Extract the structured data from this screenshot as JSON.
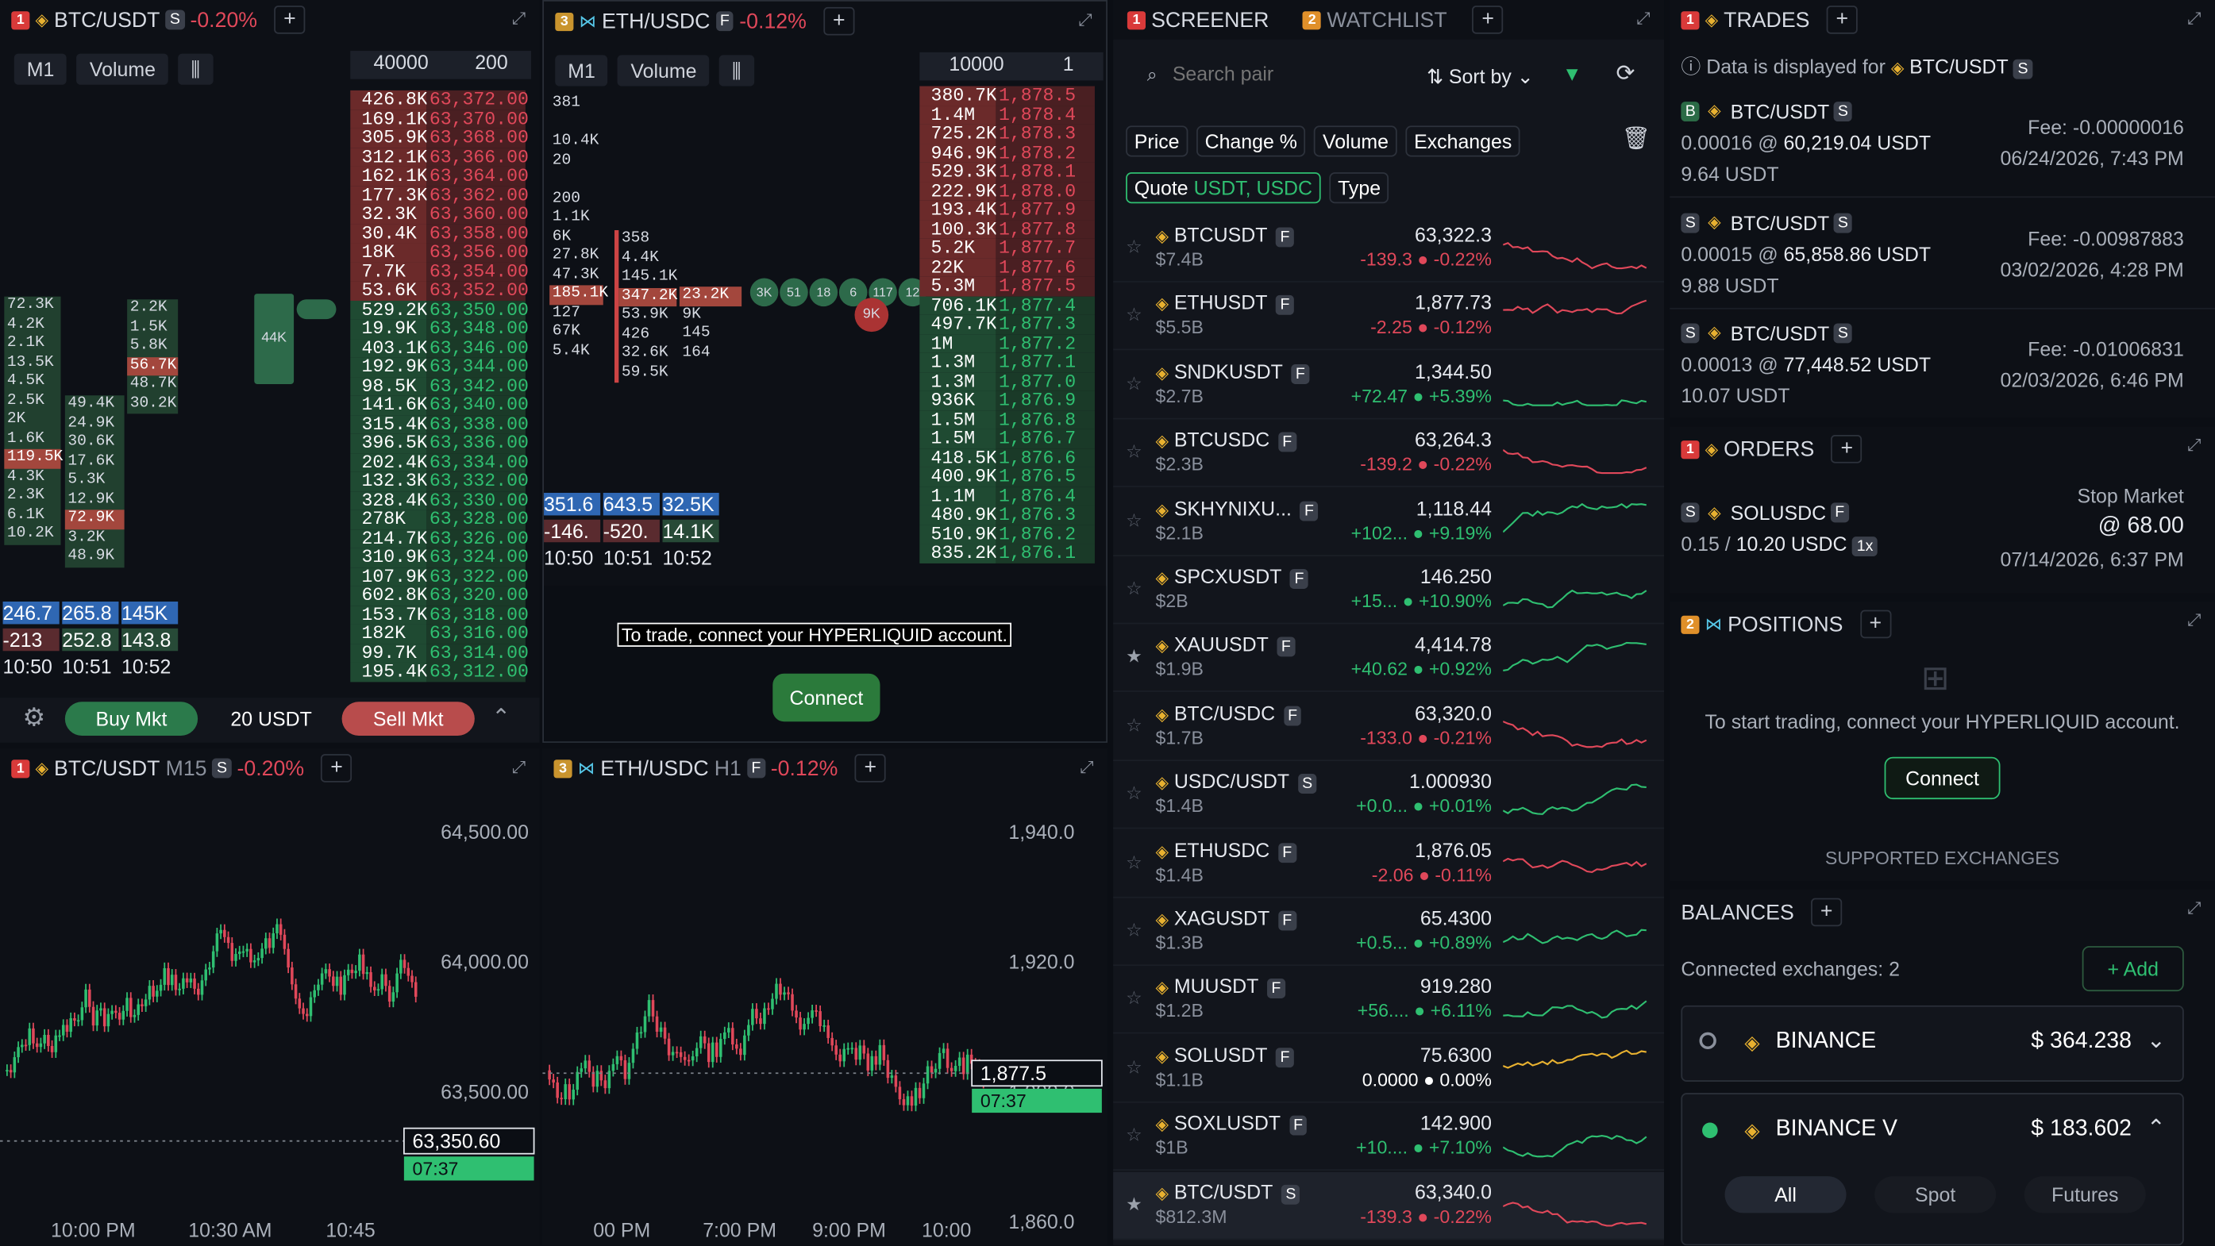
{
  "p1": {
    "num": "1",
    "symbol": "BTC/USDT",
    "market": "S",
    "change": "-0.20%",
    "tf": "M1",
    "indicator": "Volume",
    "ob_hdr_size": "40000",
    "ob_hdr_step": "200",
    "ob_sizes": [
      "426.8K",
      "169.1K",
      "305.9K",
      "312.1K",
      "162.1K",
      "177.3K",
      "32.3K",
      "30.4K",
      "18K",
      "7.7K",
      "53.6K",
      "529.2K",
      "19.9K",
      "403.1K",
      "192.9K",
      "98.5K",
      "141.6K",
      "315.4K",
      "396.5K",
      "202.4K",
      "132.3K",
      "328.4K",
      "278K",
      "214.7K",
      "310.9K",
      "107.9K",
      "602.8K",
      "153.7K",
      "182K",
      "99.7K",
      "195.4K"
    ],
    "ob_prices": [
      "63,372.00",
      "63,370.00",
      "63,368.00",
      "63,366.00",
      "63,364.00",
      "63,362.00",
      "63,360.00",
      "63,358.00",
      "63,356.00",
      "63,354.00",
      "63,352.00",
      "63,350.00",
      "63,348.00",
      "63,346.00",
      "63,344.00",
      "63,342.00",
      "63,340.00",
      "63,338.00",
      "63,336.00",
      "63,334.00",
      "63,332.00",
      "63,330.00",
      "63,328.00",
      "63,326.00",
      "63,324.00",
      "63,322.00",
      "63,320.00",
      "63,318.00",
      "63,316.00",
      "63,314.00",
      "63,312.00"
    ],
    "fp_c1": [
      "72.3K",
      "4.2K",
      "2.1K",
      "13.5K",
      "4.5K",
      "2.5K",
      "2K",
      "1.6K",
      "119.5K",
      "4.3K",
      "2.3K",
      "6.1K",
      "10.2K"
    ],
    "fp_c2": [
      "49.4K",
      "24.9K",
      "30.6K",
      "17.6K",
      "5.3K",
      "12.9K",
      "72.9K",
      "3.2K",
      "48.9K"
    ],
    "fp_c3": [
      "2.2K",
      "1.5K",
      "5.8K",
      "56.7K",
      "48.7K",
      "30.2K"
    ],
    "bubble": "44K",
    "d1": [
      "246.7",
      "265.8",
      "145K"
    ],
    "d2": [
      "-213",
      "252.8",
      "143.8"
    ],
    "times": [
      "10:50",
      "10:51",
      "10:52"
    ],
    "buy": "Buy Mkt",
    "amount": "20 USDT",
    "sell": "Sell Mkt"
  },
  "p2": {
    "num": "3",
    "symbol": "ETH/USDC",
    "market": "F",
    "change": "-0.12%",
    "tf": "M1",
    "indicator": "Volume",
    "ob_hdr_size": "10000",
    "ob_hdr_step": "1",
    "ob_sizes": [
      "380.7K",
      "1.4M",
      "725.2K",
      "946.9K",
      "529.3K",
      "222.9K",
      "193.4K",
      "100.3K",
      "5.2K",
      "22K",
      "5.3M",
      "706.1K",
      "497.7K",
      "1M",
      "1.3M",
      "1.3M",
      "936K",
      "1.5M",
      "1.5M",
      "418.5K",
      "400.9K",
      "1.1M",
      "480.9K",
      "510.9K",
      "835.2K"
    ],
    "ob_prices": [
      "1,878.5",
      "1,878.4",
      "1,878.3",
      "1,878.2",
      "1,878.1",
      "1,878.0",
      "1,877.9",
      "1,877.8",
      "1,877.7",
      "1,877.6",
      "1,877.5",
      "1,877.4",
      "1,877.3",
      "1,877.2",
      "1,877.1",
      "1,877.0",
      "1,876.9",
      "1,876.8",
      "1,876.7",
      "1,876.6",
      "1,876.5",
      "1,876.4",
      "1,876.3",
      "1,876.2",
      "1,876.1"
    ],
    "fp_c0": [
      "381",
      "",
      "10.4K",
      "20",
      "",
      "200",
      "1.1K",
      "6K",
      "27.8K",
      "47.3K",
      "185.1K",
      "127",
      "67K",
      "5.4K"
    ],
    "fp_c1": [
      "358",
      "4.4K",
      "145.1K",
      "347.2K",
      "53.9K",
      "426",
      "32.6K",
      "59.5K"
    ],
    "fp_c2": [
      "23.2K",
      "9K",
      "145",
      "164"
    ],
    "bubbles": [
      "3K",
      "51",
      "18",
      "6",
      "117",
      "12"
    ],
    "bubble_red": "9K",
    "d1": [
      "351.6",
      "643.5",
      "32.5K"
    ],
    "d2": [
      "-146.",
      "-520.",
      "14.1K"
    ],
    "times": [
      "10:50",
      "10:51",
      "10:52"
    ],
    "connect_msg": "To trade, connect your HYPERLIQUID account.",
    "connect": "Connect"
  },
  "p3": {
    "num": "1",
    "symbol": "BTC/USDT",
    "tf": "M15",
    "market": "S",
    "change": "-0.20%",
    "yticks": [
      "64,500.00",
      "64,000.00",
      "63,500.00"
    ],
    "xticks": [
      "10:00 PM",
      "10:30 AM",
      "10:45"
    ],
    "price": "63,350.60",
    "countdown": "07:37"
  },
  "p4": {
    "num": "3",
    "symbol": "ETH/USDC",
    "tf": "H1",
    "market": "F",
    "change": "-0.12%",
    "yticks": [
      "1,940.0",
      "1,920.0",
      "1,900.0",
      "1,860.0"
    ],
    "xticks": [
      "00 PM",
      "7:00 PM",
      "9:00 PM",
      "10:00"
    ],
    "price": "1,877.5",
    "countdown": "07:37"
  },
  "screener": {
    "tab1_num": "1",
    "tab1": "SCREENER",
    "tab2_num": "2",
    "tab2": "WATCHLIST",
    "search_placeholder": "Search pair",
    "sort": "Sort by",
    "filters": [
      "Price",
      "Change %",
      "Volume",
      "Exchanges"
    ],
    "quote_label": "Quote",
    "quote_values": "USDT, USDC",
    "type": "Type",
    "rows": [
      {
        "sym": "BTCUSDT",
        "m": "F",
        "vol": "$7.4B",
        "px": "63,322.3",
        "abs": "-139.3",
        "pct": "-0.22%",
        "c": "neg",
        "star": false
      },
      {
        "sym": "ETHUSDT",
        "m": "F",
        "vol": "$5.5B",
        "px": "1,877.73",
        "abs": "-2.25",
        "pct": "-0.12%",
        "c": "neg",
        "star": false
      },
      {
        "sym": "SNDKUSDT",
        "m": "F",
        "vol": "$2.7B",
        "px": "1,344.50",
        "abs": "+72.47",
        "pct": "+5.39%",
        "c": "pos",
        "star": false
      },
      {
        "sym": "BTCUSDC",
        "m": "F",
        "vol": "$2.3B",
        "px": "63,264.3",
        "abs": "-139.2",
        "pct": "-0.22%",
        "c": "neg",
        "star": false
      },
      {
        "sym": "SKHYNIXU...",
        "m": "F",
        "vol": "$2.1B",
        "px": "1,118.44",
        "abs": "+102...",
        "pct": "+9.19%",
        "c": "pos",
        "star": false
      },
      {
        "sym": "SPCXUSDT",
        "m": "F",
        "vol": "$2B",
        "px": "146.250",
        "abs": "+15...",
        "pct": "+10.90%",
        "c": "pos",
        "star": false
      },
      {
        "sym": "XAUUSDT",
        "m": "F",
        "vol": "$1.9B",
        "px": "4,414.78",
        "abs": "+40.62",
        "pct": "+0.92%",
        "c": "pos",
        "star": true
      },
      {
        "sym": "BTC/USDC",
        "m": "F",
        "vol": "$1.7B",
        "px": "63,320.0",
        "abs": "-133.0",
        "pct": "-0.21%",
        "c": "neg",
        "star": false
      },
      {
        "sym": "USDC/USDT",
        "m": "S",
        "vol": "$1.4B",
        "px": "1.000930",
        "abs": "+0.0...",
        "pct": "+0.01%",
        "c": "pos",
        "star": false
      },
      {
        "sym": "ETHUSDC",
        "m": "F",
        "vol": "$1.4B",
        "px": "1,876.05",
        "abs": "-2.06",
        "pct": "-0.11%",
        "c": "neg",
        "star": false
      },
      {
        "sym": "XAGUSDT",
        "m": "F",
        "vol": "$1.3B",
        "px": "65.4300",
        "abs": "+0.5...",
        "pct": "+0.89%",
        "c": "pos",
        "star": false
      },
      {
        "sym": "MUUSDT",
        "m": "F",
        "vol": "$1.2B",
        "px": "919.280",
        "abs": "+56....",
        "pct": "+6.11%",
        "c": "pos",
        "star": false
      },
      {
        "sym": "SOLUSDT",
        "m": "F",
        "vol": "$1.1B",
        "px": "75.6300",
        "abs": "0.0000",
        "pct": "0.00%",
        "c": "flat",
        "star": false
      },
      {
        "sym": "SOXLUSDT",
        "m": "F",
        "vol": "$1B",
        "px": "142.900",
        "abs": "+10....",
        "pct": "+7.10%",
        "c": "pos",
        "star": false
      },
      {
        "sym": "BTC/USDT",
        "m": "S",
        "vol": "$812.3M",
        "px": "63,340.0",
        "abs": "-139.3",
        "pct": "-0.22%",
        "c": "neg",
        "star": true
      }
    ]
  },
  "trades": {
    "num": "1",
    "title": "TRADES",
    "info": "Data is displayed for",
    "info_sym": "BTC/USDT",
    "info_m": "S",
    "items": [
      {
        "side": "B",
        "sym": "BTC/USDT",
        "m": "S",
        "qty": "0.00016",
        "px": "60,219.04 USDT",
        "total": "9.64 USDT",
        "fee": "Fee: -0.00000016",
        "date": "06/24/2026, 7:43 PM"
      },
      {
        "side": "S",
        "sym": "BTC/USDT",
        "m": "S",
        "qty": "0.00015",
        "px": "65,858.86 USDT",
        "total": "9.88 USDT",
        "fee": "Fee: -0.00987883",
        "date": "03/02/2026, 4:28 PM"
      },
      {
        "side": "S",
        "sym": "BTC/USDT",
        "m": "S",
        "qty": "0.00013",
        "px": "77,448.52 USDT",
        "total": "10.07 USDT",
        "fee": "Fee: -0.01006831",
        "date": "02/03/2026, 6:46 PM"
      }
    ]
  },
  "orders": {
    "num": "1",
    "title": "ORDERS",
    "side": "S",
    "sym": "SOLUSDC",
    "m": "F",
    "qty": "0.15",
    "total": "10.20 USDC",
    "lev": "1x",
    "type": "Stop Market",
    "price": "@ 68.00",
    "date": "07/14/2026, 6:37 PM"
  },
  "positions": {
    "num": "2",
    "title": "POSITIONS",
    "msg": "To start trading, connect your HYPERLIQUID account.",
    "connect": "Connect",
    "supported": "SUPPORTED EXCHANGES"
  },
  "balances": {
    "title": "BALANCES",
    "connected": "Connected exchanges: 2",
    "add": "Add",
    "ex1": "BINANCE",
    "ex1_val": "$ 364.238",
    "ex2": "BINANCE V",
    "ex2_val": "$ 183.602",
    "tabs": [
      "All",
      "Spot",
      "Futures"
    ]
  },
  "colors": {
    "bg": "#0b0e14",
    "green": "#2fbf71",
    "red": "#e0485a",
    "accent": "#e8b130"
  }
}
